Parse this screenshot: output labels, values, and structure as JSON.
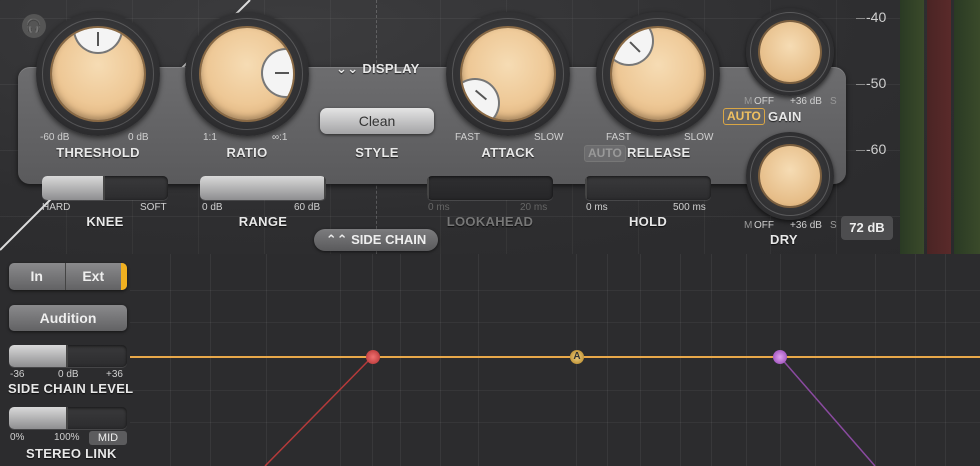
{
  "colors": {
    "accent_orange": "#f0b020",
    "knob_face": "#eec896",
    "curve_line": "#e8a84a",
    "node_red": "#e05555",
    "node_purple": "#c06ad0",
    "node_gold": "#e0b040"
  },
  "header": {
    "headphones_icon": "headphones-icon",
    "display_label": "DISPLAY",
    "display_icon": "chevron-double-down-icon"
  },
  "knobs": {
    "threshold": {
      "label": "THRESHOLD",
      "min": "-60 dB",
      "max": "0 dB"
    },
    "ratio": {
      "label": "RATIO",
      "min": "1:1",
      "max": "∞:1"
    },
    "attack": {
      "label": "ATTACK",
      "min": "FAST",
      "max": "SLOW"
    },
    "release": {
      "label": "RELEASE",
      "min": "FAST",
      "max": "SLOW",
      "auto": "AUTO"
    },
    "gain": {
      "label": "GAIN",
      "m": "M",
      "min": "OFF",
      "max": "+36 dB",
      "s": "S",
      "auto": "AUTO"
    },
    "dry": {
      "label": "DRY",
      "m": "M",
      "min": "OFF",
      "max": "+36 dB",
      "s": "S"
    }
  },
  "style": {
    "label": "STYLE",
    "value": "Clean"
  },
  "sliders": {
    "knee": {
      "label": "KNEE",
      "min": "HARD",
      "max": "SOFT",
      "level": 0.5
    },
    "range": {
      "label": "RANGE",
      "min": "0 dB",
      "max": "60 dB",
      "level": 1.0
    },
    "lookahead": {
      "label": "LOOKAHEAD",
      "min": "0 ms",
      "max": "20 ms",
      "level": 0.0
    },
    "hold": {
      "label": "HOLD",
      "min": "0 ms",
      "max": "500 ms",
      "level": 0.0
    }
  },
  "side_chain_toggle": {
    "label": "SIDE CHAIN",
    "icon": "chevron-double-up-icon"
  },
  "range_badge": "72 dB",
  "scale": [
    "-40",
    "-50",
    "-60"
  ],
  "side_chain": {
    "in_label": "In",
    "ext_label": "Ext",
    "audition_label": "Audition",
    "level": {
      "label": "SIDE CHAIN LEVEL",
      "min": "-36",
      "mid": "0 dB",
      "max": "+36",
      "level": 0.5
    },
    "stereo_link": {
      "label": "STEREO LINK",
      "min": "0%",
      "max": "100%",
      "mode": "MID",
      "level": 0.5
    }
  },
  "eq_nodes": {
    "a_label": "A"
  }
}
